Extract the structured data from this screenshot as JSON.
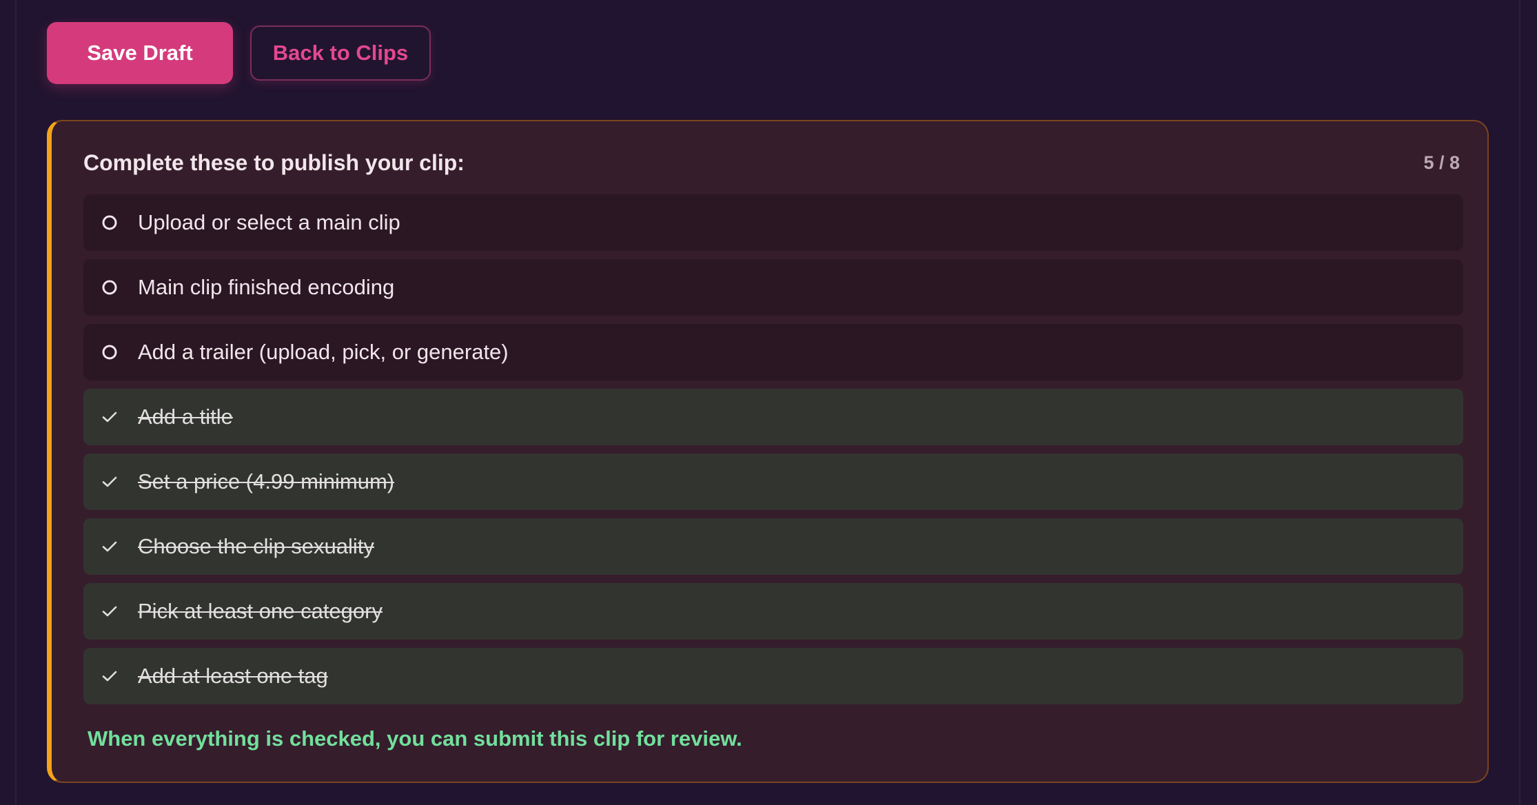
{
  "toolbar": {
    "save_label": "Save Draft",
    "back_label": "Back to Clips"
  },
  "checklist": {
    "title": "Complete these to publish your clip:",
    "progress": "5 / 8",
    "accent_color": "#f4a31b",
    "items": [
      {
        "label": "Upload or select a main clip",
        "done": false,
        "icon": "circle-icon"
      },
      {
        "label": "Main clip finished encoding",
        "done": false,
        "icon": "circle-icon"
      },
      {
        "label": "Add a trailer (upload, pick, or generate)",
        "done": false,
        "icon": "circle-icon"
      },
      {
        "label": "Add a title",
        "done": true,
        "icon": "check-icon"
      },
      {
        "label": "Set a price (4.99 minimum)",
        "done": true,
        "icon": "check-icon"
      },
      {
        "label": "Choose the clip sexuality",
        "done": true,
        "icon": "check-icon"
      },
      {
        "label": "Pick at least one category",
        "done": true,
        "icon": "check-icon"
      },
      {
        "label": "Add at least one tag",
        "done": true,
        "icon": "check-icon"
      }
    ],
    "footer_note": "When everything is checked, you can submit this clip for review."
  },
  "colors": {
    "primary": "#d53a7c",
    "background": "#211430",
    "success_text": "#71e09c"
  }
}
